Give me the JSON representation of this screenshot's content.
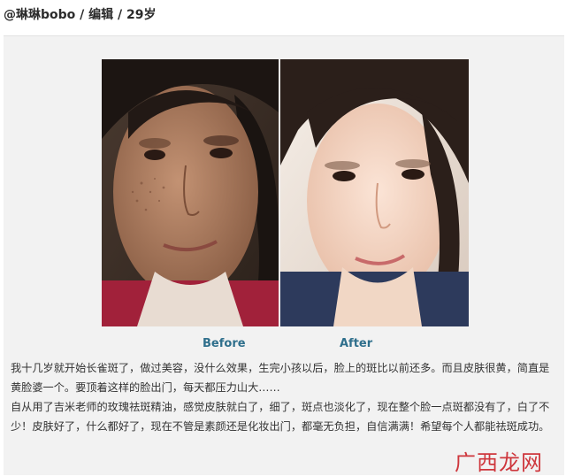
{
  "header": {
    "title": "@琳琳bobo / 编辑 / 29岁"
  },
  "photos": {
    "before_label": "Before",
    "after_label": "After"
  },
  "article": {
    "paragraph_1": "我十几岁就开始长雀斑了，做过美容，没什么效果，生完小孩以后，脸上的斑比以前还多。而且皮肤很黄，简直是黄脸婆一个。要顶着这样的脸出门，每天都压力山大……",
    "paragraph_2": "自从用了吉米老师的玫瑰祛斑精油，感觉皮肤就白了，细了，斑点也淡化了，现在整个脸一点斑都没有了，白了不少！皮肤好了，什么都好了，现在不管是素颜还是化妆出门，都毫无负担，自信满满！希望每个人都能祛斑成功。"
  },
  "watermark": {
    "text": "广西龙网"
  },
  "colors": {
    "label": "#2f6f8c",
    "watermark": "#c8161d",
    "card_background": "#f2f2f2"
  }
}
